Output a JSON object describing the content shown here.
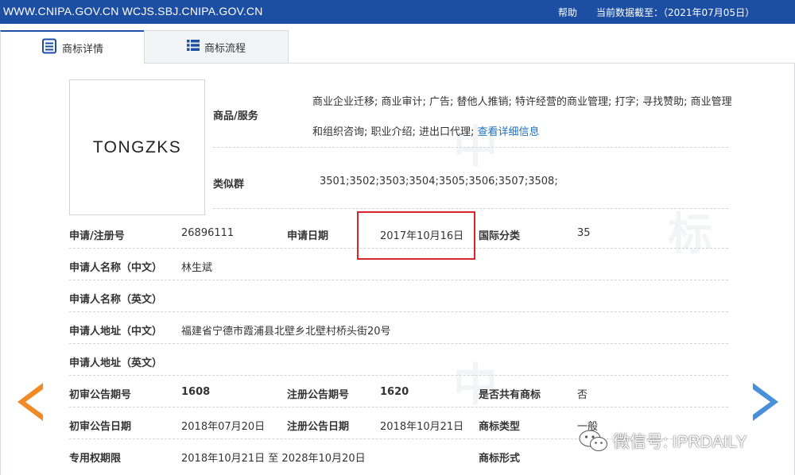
{
  "header": {
    "sites": "WWW.CNIPA.GOV.CN WCJS.SBJ.CNIPA.GOV.CN",
    "help": "帮助",
    "data_date": "当前数据截至：（2021年07月05日）"
  },
  "tabs": [
    {
      "label": "商标详情",
      "icon": "document-list-icon",
      "active": true
    },
    {
      "label": "商标流程",
      "icon": "list-icon",
      "active": false
    }
  ],
  "trademark": {
    "logo_text": "TONGZKS",
    "goods_label": "商品/服务",
    "goods_text": "商业企业迁移; 商业审计; 广告; 替他人推销; 特许经营的商业管理; 打字; 寻找赞助; 商业管理和组织咨询; 职业介绍; 进出口代理;",
    "goods_link": "查看详细信息",
    "similar_label": "类似群",
    "similar_value": "3501;3502;3503;3504;3505;3506;3507;3508;"
  },
  "fields": {
    "reg_no_label": "申请/注册号",
    "reg_no": "26896111",
    "apply_date_label": "申请日期",
    "apply_date": "2017年10月16日",
    "intl_class_label": "国际分类",
    "intl_class": "35",
    "applicant_cn_label": "申请人名称（中文）",
    "applicant_cn": "林生斌",
    "applicant_en_label": "申请人名称（英文）",
    "applicant_en": "",
    "address_cn_label": "申请人地址（中文）",
    "address_cn": "福建省宁德市霞浦县北壁乡北壁村桥头街20号",
    "address_en_label": "申请人地址（英文）",
    "address_en": "",
    "prelim_no_label": "初审公告期号",
    "prelim_no": "1608",
    "reg_pub_no_label": "注册公告期号",
    "reg_pub_no": "1620",
    "shared_label": "是否共有商标",
    "shared": "否",
    "prelim_date_label": "初审公告日期",
    "prelim_date": "2018年07月20日",
    "reg_pub_date_label": "注册公告日期",
    "reg_pub_date": "2018年10月21日",
    "type_label": "商标类型",
    "type": "一般",
    "term_label": "专用权期限",
    "term": "2018年10月21日 至 2028年10月20日",
    "form_label": "商标形式",
    "form": ""
  },
  "watermark": {
    "text": "微信号: IPRDAILY",
    "icon": "wechat-icon"
  },
  "colors": {
    "header_bg": "#1c4ea3",
    "highlight": "#d9252b",
    "prev_arrow": "#f08a24",
    "next_arrow": "#4a90d9",
    "link": "#1a73c2"
  }
}
